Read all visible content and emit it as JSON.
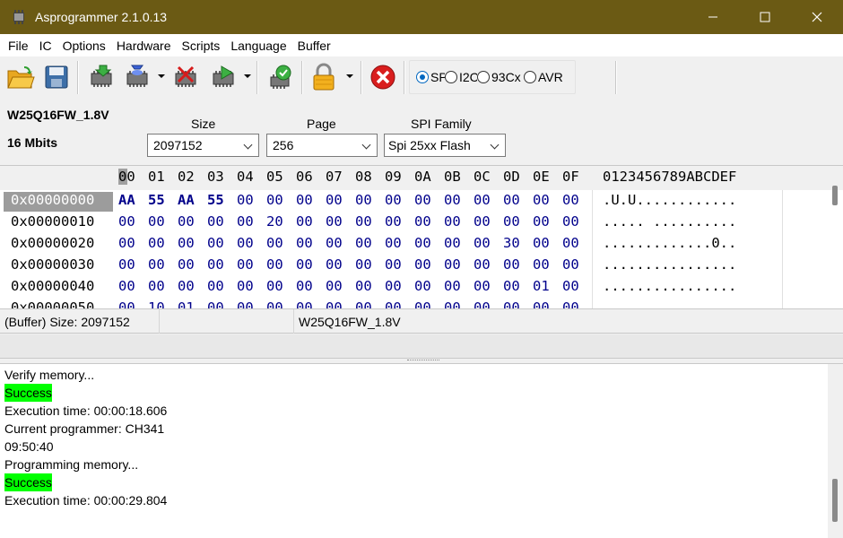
{
  "window": {
    "title": "Asprogrammer 2.1.0.13"
  },
  "menu": [
    "File",
    "IC",
    "Options",
    "Hardware",
    "Scripts",
    "Language",
    "Buffer"
  ],
  "toolbar": {
    "icons": [
      "open-icon",
      "save-icon",
      "read-chip-icon",
      "write-chip-icon",
      "erase-chip-icon",
      "verify-chip-icon",
      "check-chip-icon",
      "lock-icon",
      "stop-icon"
    ],
    "modes": [
      {
        "label": "SPI",
        "selected": true
      },
      {
        "label": "I2C",
        "selected": false
      },
      {
        "label": "93Cx",
        "selected": false
      },
      {
        "label": "AVR",
        "selected": false
      }
    ]
  },
  "chip": {
    "name": "W25Q16FW_1.8V",
    "capacity": "16 Mbits",
    "size_label": "Size",
    "size_value": "2097152",
    "page_label": "Page",
    "page_value": "256",
    "family_label": "SPI Family",
    "family_value": "Spi 25xx Flash"
  },
  "hex": {
    "columns": [
      "00",
      "01",
      "02",
      "03",
      "04",
      "05",
      "06",
      "07",
      "08",
      "09",
      "0A",
      "0B",
      "0C",
      "0D",
      "0E",
      "0F"
    ],
    "ascii_header": "0123456789ABCDEF",
    "rows": [
      {
        "address": "0x00000000",
        "bytes": [
          "AA",
          "55",
          "AA",
          "55",
          "00",
          "00",
          "00",
          "00",
          "00",
          "00",
          "00",
          "00",
          "00",
          "00",
          "00",
          "00"
        ],
        "ascii": ".U.U............"
      },
      {
        "address": "0x00000010",
        "bytes": [
          "00",
          "00",
          "00",
          "00",
          "00",
          "20",
          "00",
          "00",
          "00",
          "00",
          "00",
          "00",
          "00",
          "00",
          "00",
          "00"
        ],
        "ascii": "..... .........."
      },
      {
        "address": "0x00000020",
        "bytes": [
          "00",
          "00",
          "00",
          "00",
          "00",
          "00",
          "00",
          "00",
          "00",
          "00",
          "00",
          "00",
          "00",
          "30",
          "00",
          "00"
        ],
        "ascii": ".............0.."
      },
      {
        "address": "0x00000030",
        "bytes": [
          "00",
          "00",
          "00",
          "00",
          "00",
          "00",
          "00",
          "00",
          "00",
          "00",
          "00",
          "00",
          "00",
          "00",
          "00",
          "00"
        ],
        "ascii": "................"
      },
      {
        "address": "0x00000040",
        "bytes": [
          "00",
          "00",
          "00",
          "00",
          "00",
          "00",
          "00",
          "00",
          "00",
          "00",
          "00",
          "00",
          "00",
          "00",
          "01",
          "00"
        ],
        "ascii": "................"
      },
      {
        "address": "0x00000050",
        "bytes": [
          "00",
          "10",
          "01",
          "00",
          "00",
          "00",
          "00",
          "00",
          "00",
          "00",
          "00",
          "00",
          "00",
          "00",
          "00",
          "00"
        ],
        "ascii": "................"
      }
    ]
  },
  "status": {
    "buffer": "(Buffer) Size: 2097152",
    "chip": "W25Q16FW_1.8V"
  },
  "log": [
    {
      "text": "Verify memory...",
      "ok": false
    },
    {
      "text": "Success",
      "ok": true
    },
    {
      "text": "Execution time: 00:00:18.606",
      "ok": false
    },
    {
      "text": "Current programmer: CH341",
      "ok": false
    },
    {
      "text": "09:50:40",
      "ok": false
    },
    {
      "text": "Programming memory...",
      "ok": false
    },
    {
      "text": "Success",
      "ok": true
    },
    {
      "text": "Execution time: 00:00:29.804",
      "ok": false
    }
  ],
  "colors": {
    "titlebar": "#6b5a14",
    "byte_text": "#00008b",
    "success_bg": "#00ff00"
  }
}
